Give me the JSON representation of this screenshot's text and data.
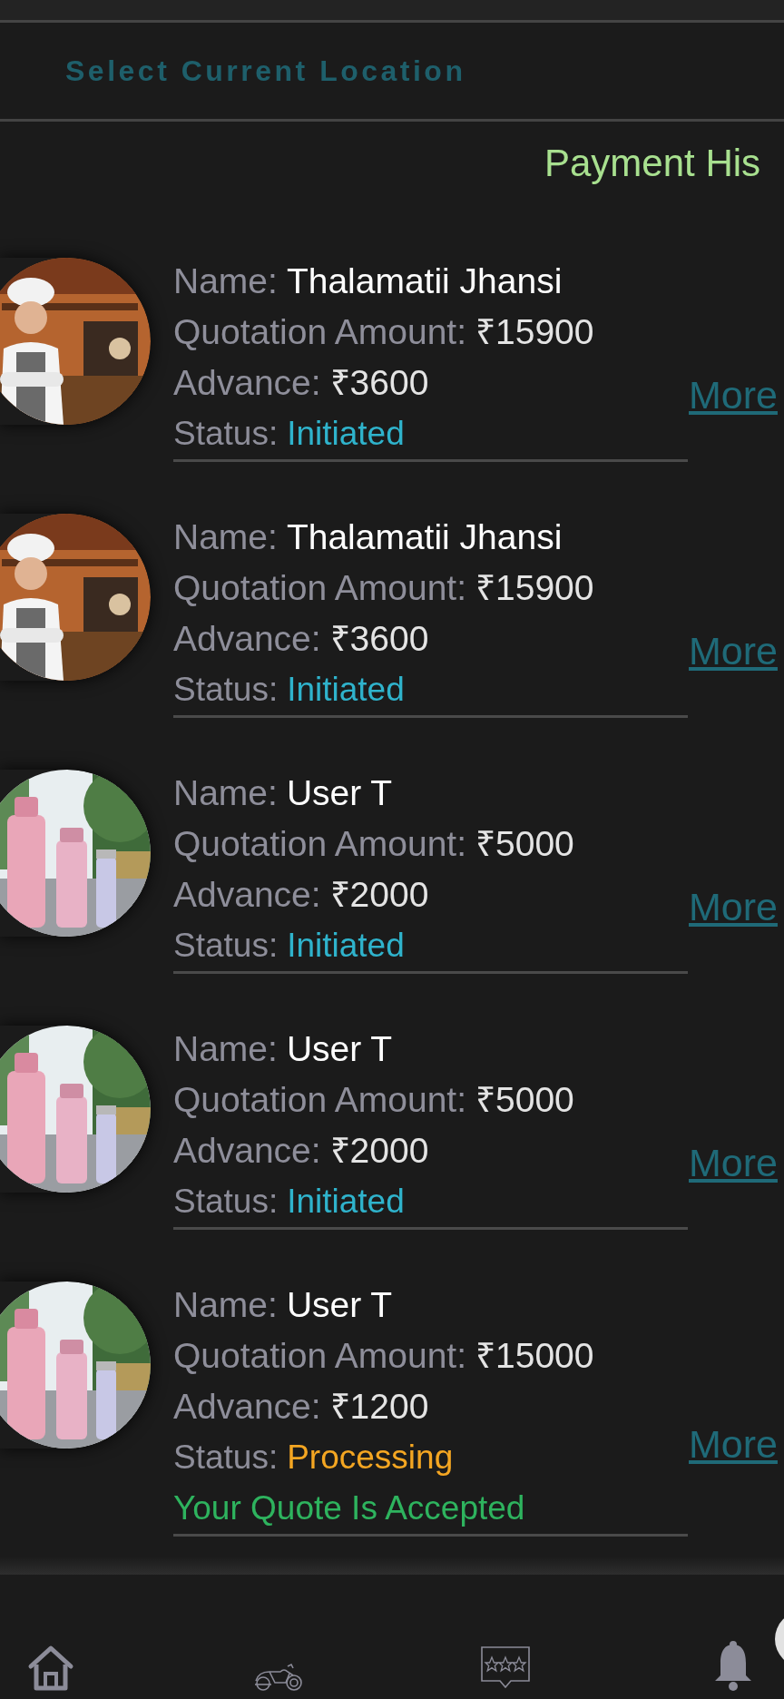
{
  "header": {
    "location_label": "Select Current Location"
  },
  "title": "Payment His",
  "payments": [
    {
      "avatar": {
        "kind": "kitchen"
      },
      "fields": [
        {
          "label": "Name:",
          "value": "Thalamatii Jhansi"
        },
        {
          "label": "Quotation Amount:",
          "value": "₹15900"
        },
        {
          "label": "Advance:",
          "value": "₹3600"
        }
      ],
      "status": {
        "label": "Status:",
        "value": "Initiated",
        "kind": "initiated"
      },
      "link": "More"
    },
    {
      "avatar": {
        "kind": "kitchen"
      },
      "fields": [
        {
          "label": "Name:",
          "value": "Thalamatii Jhansi"
        },
        {
          "label": "Quotation Amount:",
          "value": "₹15900"
        },
        {
          "label": "Advance:",
          "value": "₹3600"
        }
      ],
      "status": {
        "label": "Status:",
        "value": "Initiated",
        "kind": "initiated"
      },
      "link": "More"
    },
    {
      "avatar": {
        "kind": "outdoor"
      },
      "fields": [
        {
          "label": "Name:",
          "value": "User T"
        },
        {
          "label": "Quotation Amount:",
          "value": "₹5000"
        },
        {
          "label": "Advance:",
          "value": "₹2000"
        }
      ],
      "status": {
        "label": "Status:",
        "value": "Initiated",
        "kind": "initiated"
      },
      "link": "More"
    },
    {
      "avatar": {
        "kind": "outdoor"
      },
      "fields": [
        {
          "label": "Name:",
          "value": "User T"
        },
        {
          "label": "Quotation Amount:",
          "value": "₹5000"
        },
        {
          "label": "Advance:",
          "value": "₹2000"
        }
      ],
      "status": {
        "label": "Status:",
        "value": "Initiated",
        "kind": "initiated"
      },
      "link": "More"
    },
    {
      "avatar": {
        "kind": "outdoor"
      },
      "fields": [
        {
          "label": "Name:",
          "value": "User T"
        },
        {
          "label": "Quotation Amount:",
          "value": "₹15000"
        },
        {
          "label": "Advance:",
          "value": "₹1200"
        }
      ],
      "status": {
        "label": "Status:",
        "value": "Processing",
        "kind": "processing"
      },
      "note": "Your Quote Is Accepted",
      "link": "More"
    }
  ],
  "nav": [
    {
      "kind": "home"
    },
    {
      "kind": "motorcycle"
    },
    {
      "kind": "reviews"
    },
    {
      "kind": "notifications"
    }
  ]
}
